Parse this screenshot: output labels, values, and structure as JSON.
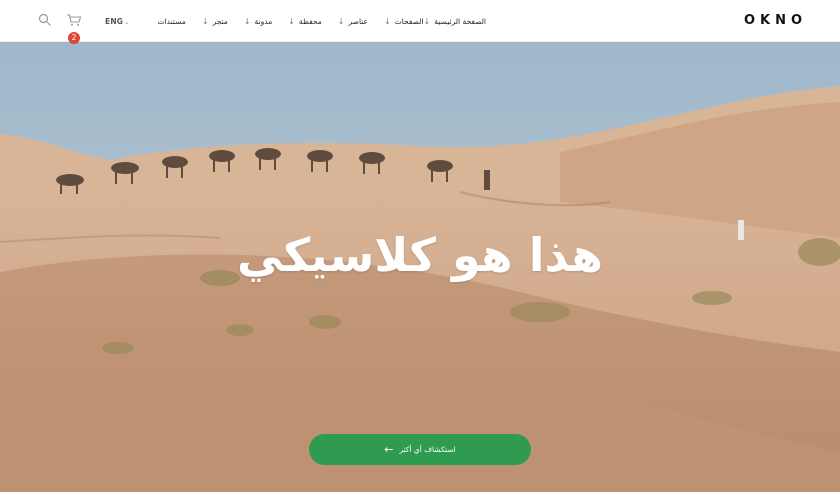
{
  "header": {
    "logo": "OKNO",
    "language": "ENG",
    "cart_count": "2",
    "nav": [
      {
        "label": "الصفحة الرئيسية"
      },
      {
        "label": "الصفحات"
      },
      {
        "label": "عناصر"
      },
      {
        "label": "محفظة"
      },
      {
        "label": "مدونة"
      },
      {
        "label": "متجر"
      },
      {
        "label": "مستندات"
      }
    ],
    "nav_arrow": "↓",
    "icons": {
      "search": "search-icon",
      "cart": "cart-icon"
    }
  },
  "hero": {
    "title": "هذا هو كلاسيكي",
    "cta_label": "استكشاف أي أكثر",
    "cta_arrow": "←"
  },
  "colors": {
    "accent": "#2e9b50",
    "badge": "#e0453a",
    "sky": "#a8bfd0",
    "sand": "#c99f80"
  }
}
